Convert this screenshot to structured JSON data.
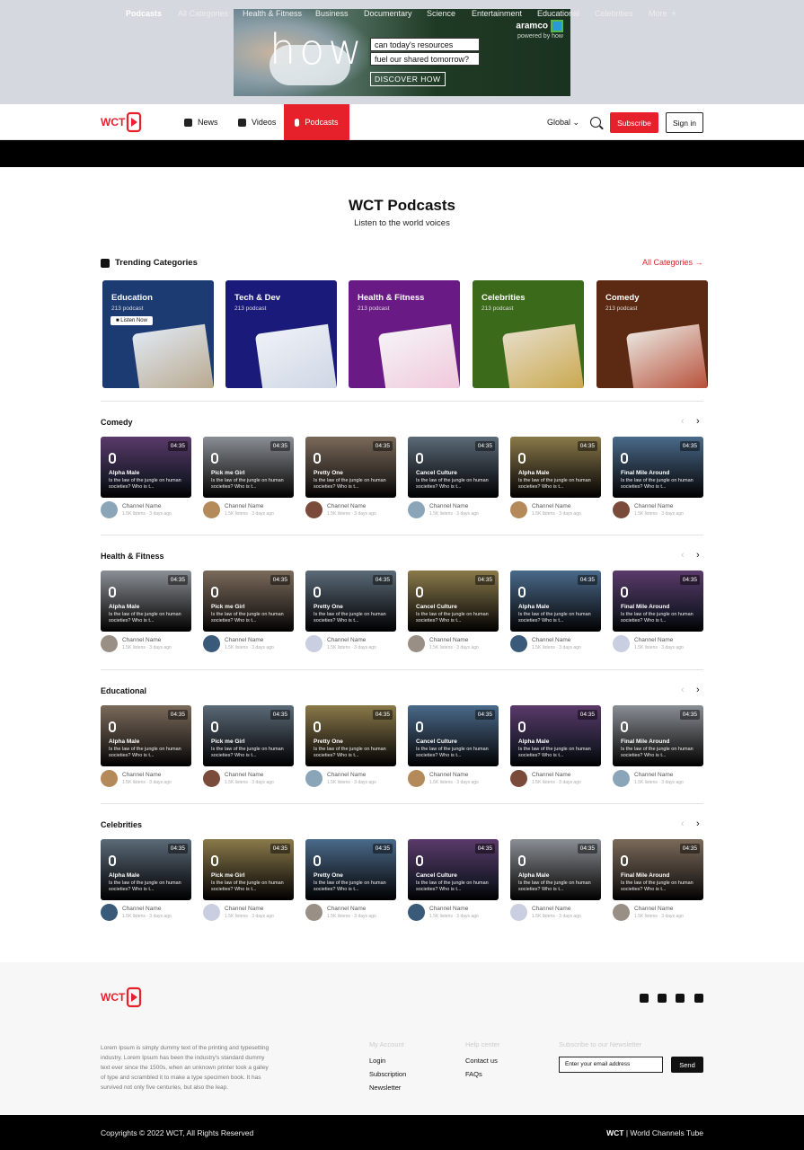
{
  "ad": {
    "headline": "how",
    "question_1": "can today's resources",
    "question_2": "fuel our shared tomorrow?",
    "cta": "DISCOVER HOW",
    "brand": "aramco",
    "powered": "powered by how"
  },
  "brand": {
    "logo_text": "WCT",
    "accent": "#e6212b"
  },
  "nav": {
    "news": "News",
    "videos": "Videos",
    "podcasts": "Podcasts",
    "region": "Global",
    "subscribe": "Subscribe",
    "signin": "Sign in"
  },
  "categories": [
    "Podcasts",
    "All Categories",
    "Health & Fitness",
    "Business",
    "Documentary",
    "Science",
    "Entertainment",
    "Educational",
    "Celebrities",
    "More"
  ],
  "hero": {
    "title": "WCT Podcasts",
    "subtitle": "Listen to the world voices"
  },
  "trending": {
    "title": "Trending Categories",
    "all_link": "All Categories",
    "listen_now": "Listen Now",
    "cards": [
      {
        "name": "Education",
        "count": "213 podcast",
        "color": "#1d3b73"
      },
      {
        "name": "Tech & Dev",
        "count": "213 podcast",
        "color": "#1a1a7a"
      },
      {
        "name": "Health & Fitness",
        "count": "213 podcast",
        "color": "#6a1a85"
      },
      {
        "name": "Celebrities",
        "count": "213 podcast",
        "color": "#3b6b1a"
      },
      {
        "name": "Comedy",
        "count": "213 podcast",
        "color": "#5c2a12"
      }
    ]
  },
  "episode": {
    "duration": "04:35",
    "desc": "Is the law of the jungle on human societies? Who is t...",
    "channel": "Channel Name",
    "info": "1.5K listens · 3 days ago"
  },
  "sections": [
    {
      "title": "Comedy",
      "items": [
        "Alpha Male",
        "Pick me Girl",
        "Pretty One",
        "Cancel Culture",
        "Alpha Male",
        "Final Mile Around"
      ]
    },
    {
      "title": "Health & Fitness",
      "items": [
        "Alpha Male",
        "Pick me Girl",
        "Pretty One",
        "Cancel Culture",
        "Alpha Male",
        "Final Mile Around"
      ]
    },
    {
      "title": "Educational",
      "items": [
        "Alpha Male",
        "Pick me Girl",
        "Pretty One",
        "Cancel Culture",
        "Alpha Male",
        "Final Mile Around"
      ]
    },
    {
      "title": "Celebrities",
      "items": [
        "Alpha Male",
        "Pick me Girl",
        "Pretty One",
        "Cancel Culture",
        "Alpha Male",
        "Final Mile Around"
      ]
    }
  ],
  "footer": {
    "about": "Lorem Ipsum is simply dummy text of the printing and typesetting industry. Lorem Ipsum has been the industry's standard dummy text ever since the 1500s, when an unknown printer took a galley of type and scrambled it to make a type specimen book. It has survived not only five centuries, but also the leap.",
    "account_head": "My Account",
    "account_links": [
      "Login",
      "Subscription",
      "Newsletter"
    ],
    "help_head": "Help center",
    "help_links": [
      "Contact us",
      "FAQs"
    ],
    "newsletter_head": "Subscribe to our Newsletter",
    "email_placeholder": "Enter your email address",
    "send": "Send",
    "copyright": "Copyrights © 2022 WCT, All Rights Reserved",
    "brand_short": "WCT",
    "brand_long": " | World Channels Tube"
  }
}
